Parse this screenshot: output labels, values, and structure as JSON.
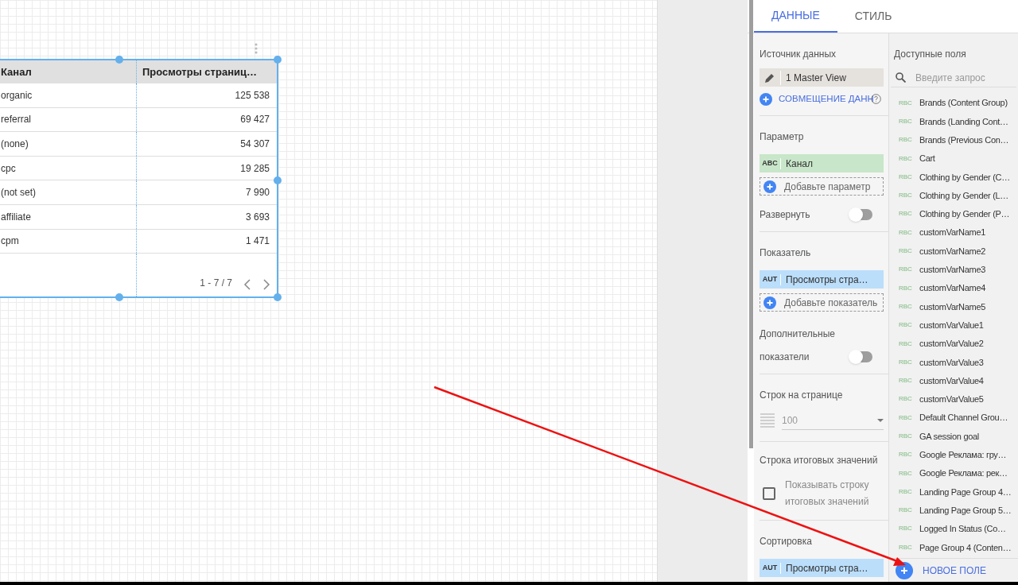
{
  "table": {
    "columns": [
      "Канал",
      "Просмотры страниц…"
    ],
    "rows": [
      [
        "organic",
        "125 538"
      ],
      [
        "referral",
        "69 427"
      ],
      [
        "(none)",
        "54 307"
      ],
      [
        "cpc",
        "19 285"
      ],
      [
        "(not set)",
        "7 990"
      ],
      [
        "affiliate",
        "3 693"
      ],
      [
        "cpm",
        "1 471"
      ]
    ],
    "pagination": "1 - 7 / 7"
  },
  "tabs": [
    {
      "label": "ДАННЫЕ",
      "selected": true
    },
    {
      "label": "СТИЛЬ",
      "selected": false
    }
  ],
  "data_source": {
    "label": "Источник данных",
    "value": "1 Master View",
    "blend_link": "СОВМЕЩЕНИЕ ДАНН"
  },
  "dimension": {
    "label": "Параметр",
    "chip_type": "ABC",
    "chip": "Канал",
    "add": "Добавьте параметр",
    "toggle_label": "Развернуть",
    "toggle_on": false
  },
  "metric": {
    "label": "Показатель",
    "chip_type": "AUT",
    "chip": "Просмотры стра…",
    "add": "Добавьте показатель",
    "toggle_label_1": "Дополнительные",
    "toggle_label_2": "показатели",
    "toggle_on": false
  },
  "rows_per_page": {
    "label": "Строк на странице",
    "value": "100"
  },
  "totals": {
    "label": "Строка итоговых значений",
    "checkbox_line_1": "Показывать строку",
    "checkbox_line_2": "итоговых значений",
    "checked": false
  },
  "sort": {
    "label": "Сортировка",
    "chip_type": "AUT",
    "chip": "Просмотры стра…"
  },
  "fields": {
    "label": "Доступные поля",
    "placeholder": "Введите запрос",
    "new_field": "НОВОЕ ПОЛЕ",
    "items": [
      {
        "type": "RBC",
        "name": "Brands (Content Group)"
      },
      {
        "type": "RBC",
        "name": "Brands (Landing Cont…"
      },
      {
        "type": "RBC",
        "name": "Brands (Previous Con…"
      },
      {
        "type": "RBC",
        "name": "Cart"
      },
      {
        "type": "RBC",
        "name": "Clothing by Gender (C…"
      },
      {
        "type": "RBC",
        "name": "Clothing by Gender (L…"
      },
      {
        "type": "RBC",
        "name": "Clothing by Gender (P…"
      },
      {
        "type": "RBC",
        "name": "customVarName1"
      },
      {
        "type": "RBC",
        "name": "customVarName2"
      },
      {
        "type": "RBC",
        "name": "customVarName3"
      },
      {
        "type": "RBC",
        "name": "customVarName4"
      },
      {
        "type": "RBC",
        "name": "customVarName5"
      },
      {
        "type": "RBC",
        "name": "customVarValue1"
      },
      {
        "type": "RBC",
        "name": "customVarValue2"
      },
      {
        "type": "RBC",
        "name": "customVarValue3"
      },
      {
        "type": "RBC",
        "name": "customVarValue4"
      },
      {
        "type": "RBC",
        "name": "customVarValue5"
      },
      {
        "type": "RBC",
        "name": "Default Channel Grou…"
      },
      {
        "type": "RBC",
        "name": "GA session goal"
      },
      {
        "type": "RBC",
        "name": "Google Реклама: гру…"
      },
      {
        "type": "RBC",
        "name": "Google Реклама: рек…"
      },
      {
        "type": "RBC",
        "name": "Landing Page Group 4…"
      },
      {
        "type": "RBC",
        "name": "Landing Page Group 5…"
      },
      {
        "type": "RBC",
        "name": "Logged In Status (Co…"
      },
      {
        "type": "RBC",
        "name": "Page Group 4 (Conten…"
      }
    ]
  }
}
